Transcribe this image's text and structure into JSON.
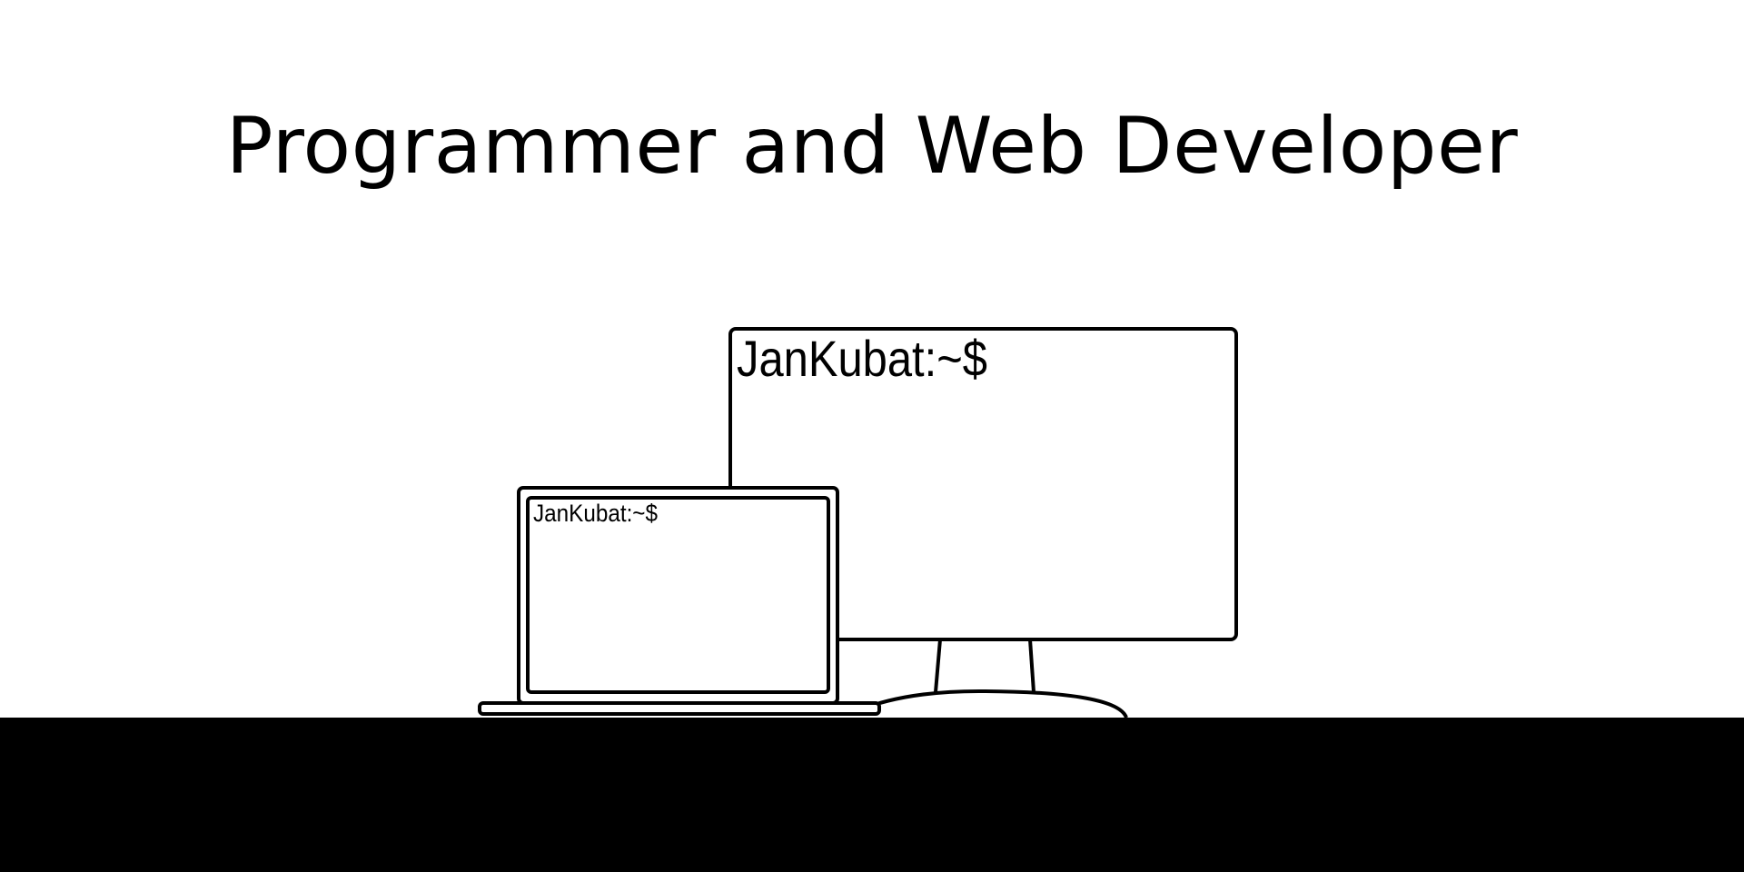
{
  "header": {
    "title": "Programmer and Web Developer"
  },
  "monitor": {
    "prompt": "JanKubat:~$"
  },
  "laptop": {
    "prompt": "JanKubat:~$"
  }
}
